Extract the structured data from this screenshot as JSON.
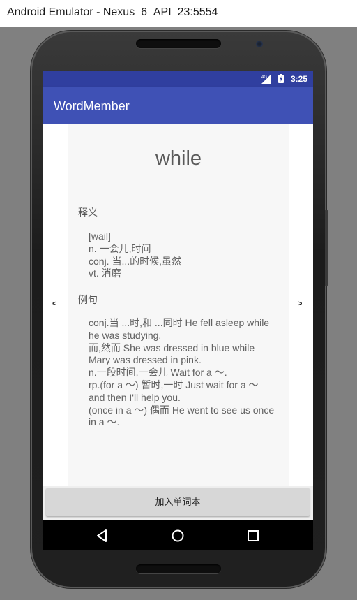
{
  "window": {
    "title": "Android Emulator - Nexus_6_API_23:5554"
  },
  "statusbar": {
    "time": "3:25",
    "network": "4G",
    "signal_icon": "signal-icon",
    "battery_icon": "battery-icon"
  },
  "appbar": {
    "title": "WordMember"
  },
  "nav": {
    "prev": "<",
    "next": ">"
  },
  "word": {
    "headword": "while",
    "definition_label": "释义",
    "definition_lines": [
      "[wail]",
      "n. 一会儿,时间",
      "conj. 当...的时候,虽然",
      "vt. 消磨"
    ],
    "example_label": "例句",
    "example_lines": [
      "conj.当 ...时,和 ...同时 He fell asleep while",
      "he was studying.",
      "而,然而 She was dressed in blue while",
      "Mary was dressed in pink.",
      "n.一段时间,一会儿 Wait for a ～.",
      "rp.(for a ～) 暂时,一时 Just wait for a ～",
      "and then I'll help you.",
      "(once in a ～) 偶而 He went to see us once",
      "in a ～."
    ]
  },
  "actions": {
    "add_to_wordbook": "加入单词本"
  },
  "system_nav": {
    "back_icon": "back-icon",
    "home_icon": "home-icon",
    "recents_icon": "recents-icon"
  },
  "colors": {
    "appbar": "#3f51b5",
    "statusbar": "#303f9f",
    "button": "#d7d7d7"
  }
}
